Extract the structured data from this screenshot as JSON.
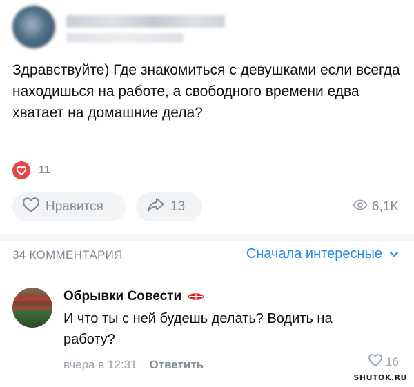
{
  "post": {
    "text": "Здравствуйте) Где знакомиться с девушками если всегда находишься на работе, а свободного времени едва хватает на домашние дела?",
    "reactions_count": "11",
    "like_label": "Нравится",
    "shares_count": "13",
    "views_count": "6,1K"
  },
  "comments_section": {
    "count_label": "34 КОММЕНТАРИЯ",
    "sort_label": "Сначала интересные"
  },
  "comment": {
    "author": "Обрывки Совести",
    "text": "И что ты с ней будешь делать? Водить на работу?",
    "time": "вчера в 12:31",
    "reply_label": "Ответить",
    "likes": "16"
  },
  "watermark": "SHUTOK.RU",
  "colors": {
    "accent": "#2688eb",
    "reaction_red": "#e64646",
    "secondary_text": "#818c99"
  },
  "icons": [
    "heart-icon",
    "share-arrow-icon",
    "eye-icon",
    "chevron-down-icon",
    "spartak-badge-icon"
  ]
}
